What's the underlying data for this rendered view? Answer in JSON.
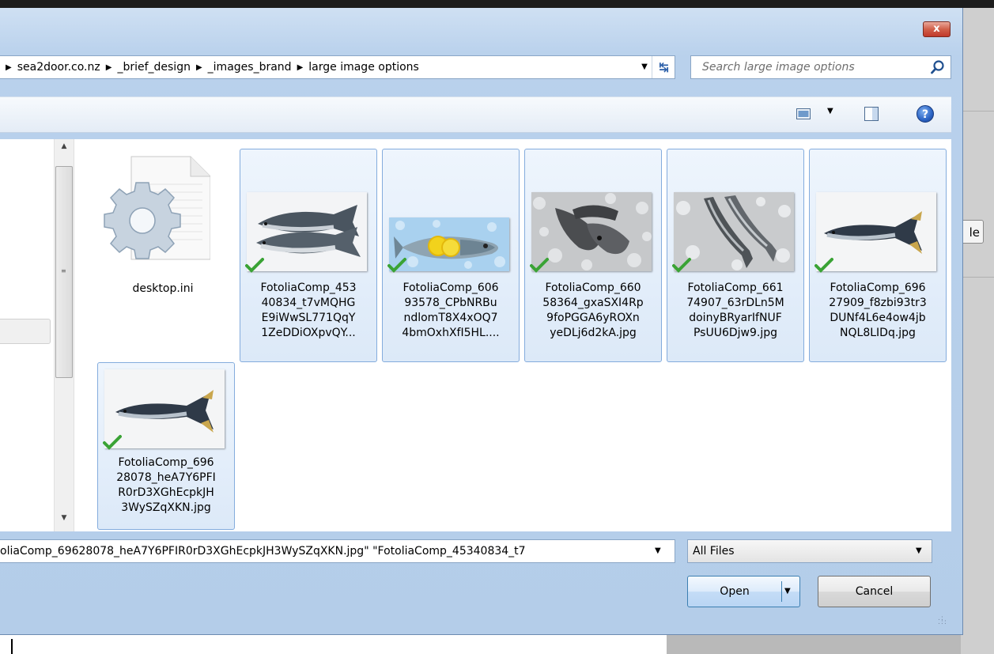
{
  "background": {
    "partial_button_text": "le"
  },
  "dialog": {
    "close_glyph": "x",
    "address": {
      "crumbs": [
        "sea2door.co.nz",
        "_brief_design",
        "_images_brand",
        "large image options"
      ],
      "separator_glyph": "▶",
      "dropdown_glyph": "▼",
      "refresh_glyph": "↹"
    },
    "search": {
      "placeholder": "Search large image options"
    },
    "toolbar": {
      "view_dropdown_glyph": "▼",
      "help_glyph": "?"
    },
    "files": [
      {
        "label": "desktop.ini",
        "selected": false,
        "icon": "settings-file-icon"
      },
      {
        "label": "FotoliaComp_45340834_t7vMQHGE9iWwSL771QqY1ZeDDiOXpvQY...",
        "label_lines": [
          "FotoliaComp_453",
          "40834_t7vMQHG",
          "E9iWwSL771QqY",
          "1ZeDDiOXpvQY..."
        ],
        "selected": true,
        "icon": "salmon-image-thumbnail"
      },
      {
        "label": "FotoliaComp_60693578_CPbNRBundlomT8X4xOQ74bmOxhXfI5HL....",
        "label_lines": [
          "FotoliaComp_606",
          "93578_CPbNRBu",
          "ndlomT8X4xOQ7",
          "4bmOxhXfI5HL...."
        ],
        "selected": true,
        "icon": "bream-lemon-image-thumbnail"
      },
      {
        "label": "FotoliaComp_66058364_gxaSXI4Rp9foPGGA6yROXnyeDLj6d2kA.jpg",
        "label_lines": [
          "FotoliaComp_660",
          "58364_gxaSXI4Rp",
          "9foPGGA6yROXn",
          "yeDLj6d2kA.jpg"
        ],
        "selected": true,
        "icon": "fish-on-ice-image-thumbnail"
      },
      {
        "label": "FotoliaComp_66174907_63rDLn5MdoinyBRyarIfNUFPsUU6Djw9.jpg",
        "label_lines": [
          "FotoliaComp_661",
          "74907_63rDLn5M",
          "doinyBRyarIfNUF",
          "PsUU6Djw9.jpg"
        ],
        "selected": true,
        "icon": "fish-pair-on-ice-image-thumbnail"
      },
      {
        "label": "FotoliaComp_69627909_f8zbi93tr3DUNf4L6e4ow4jbNQL8LIDq.jpg",
        "label_lines": [
          "FotoliaComp_696",
          "27909_f8zbi93tr3",
          "DUNf4L6e4ow4jb",
          "NQL8LIDq.jpg"
        ],
        "selected": true,
        "icon": "tuna-image-thumbnail"
      },
      {
        "label": "FotoliaComp_69628078_heA7Y6PFIR0rD3XGhEcpkJH3WySZqXKN.jpg",
        "label_lines": [
          "FotoliaComp_696",
          "28078_heA7Y6PFI",
          "R0rD3XGhEcpkJH",
          "3WySZqXKN.jpg"
        ],
        "selected": true,
        "icon": "tuna-image-thumbnail"
      }
    ],
    "filename_value": "oliaComp_69628078_heA7Y6PFIR0rD3XGhEcpkJH3WySZqXKN.jpg\" \"FotoliaComp_45340834_t7",
    "filename_dropdown_glyph": "▼",
    "filetype": {
      "selected": "All Files",
      "arrow_glyph": "▼"
    },
    "buttons": {
      "open": "Open",
      "open_arrow_glyph": "▼",
      "cancel": "Cancel"
    },
    "scroll": {
      "up_glyph": "▲",
      "down_glyph": "▼",
      "grip_glyph": "≡"
    }
  }
}
